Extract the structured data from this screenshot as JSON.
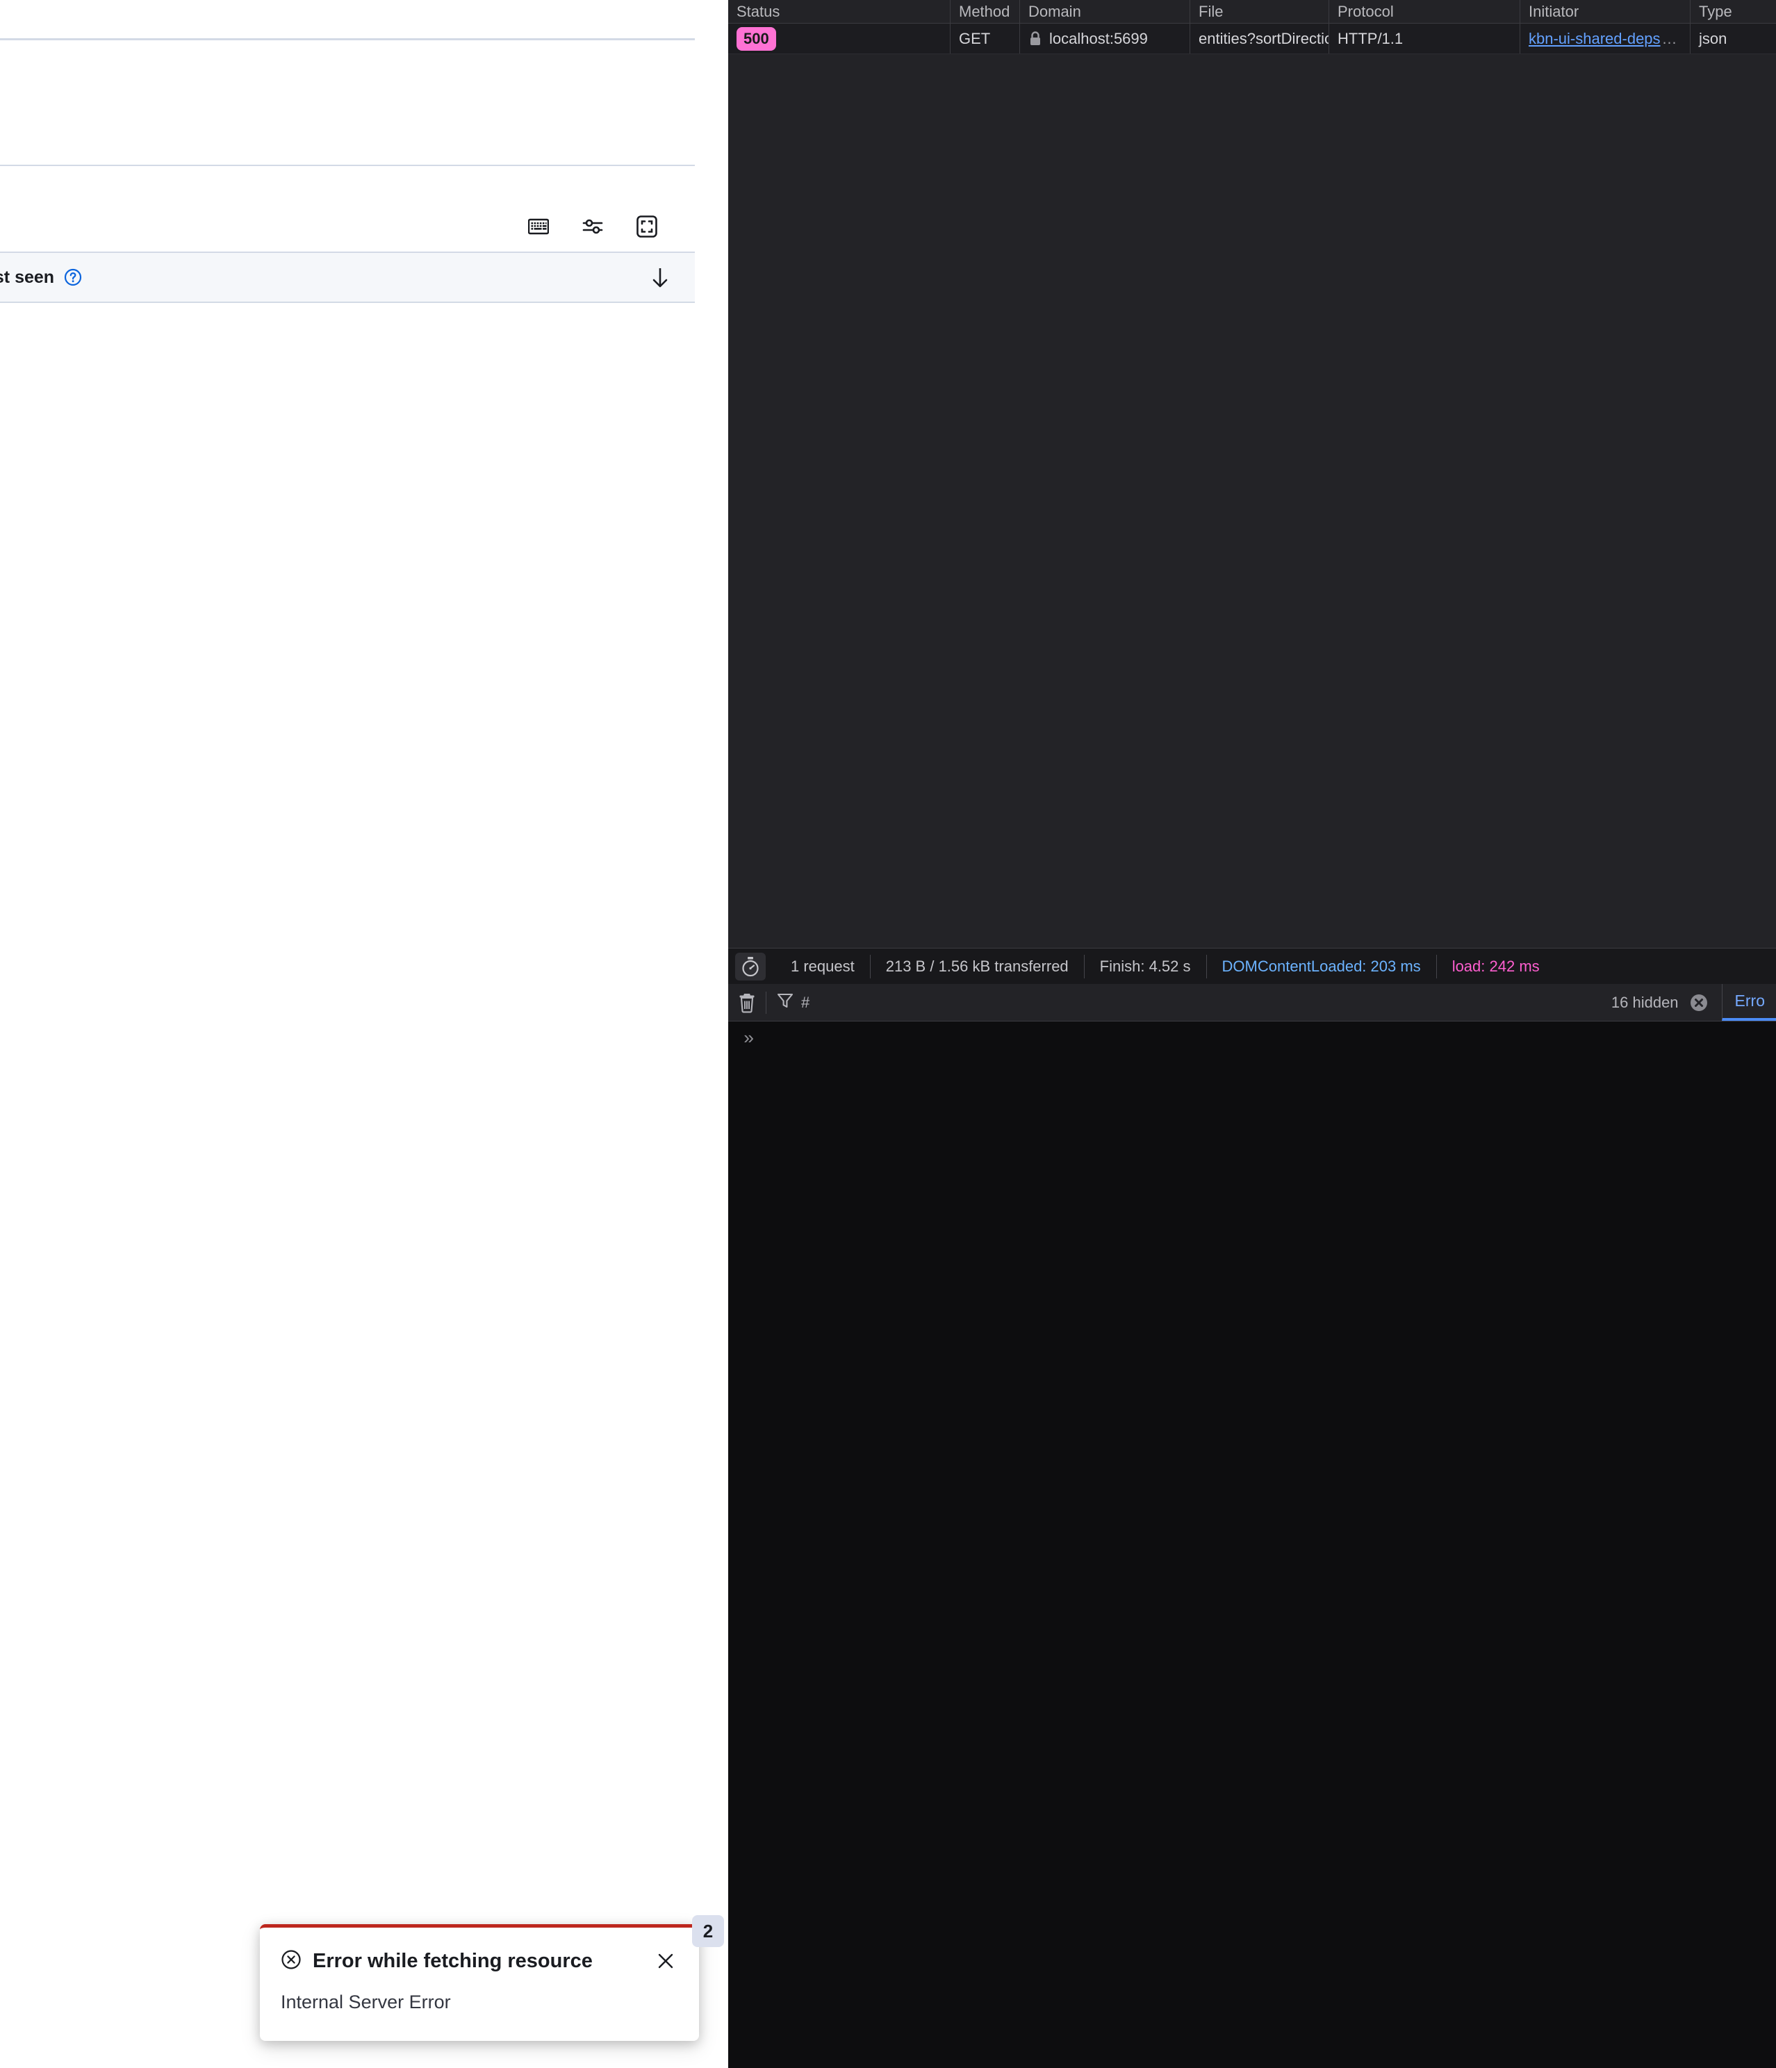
{
  "app": {
    "toolbar_icons": [
      {
        "name": "keyboard-shortcuts-icon",
        "label": "Keyboard shortcuts"
      },
      {
        "name": "display-options-icon",
        "label": "Display options"
      },
      {
        "name": "fullscreen-icon",
        "label": "Full screen"
      }
    ],
    "table": {
      "column_header": "ast seen",
      "help_icon": "help-circle-icon",
      "sort_icon": "sort-descending-arrow-icon"
    }
  },
  "devtools": {
    "network": {
      "columns": [
        "Status",
        "Method",
        "Domain",
        "File",
        "Protocol",
        "Initiator",
        "Type"
      ],
      "rows": [
        {
          "status": "500",
          "status_color": "#ff72d4",
          "method": "GET",
          "domain": "localhost:5699",
          "domain_icon": "lock-icon",
          "file": "entities?sortDirectio",
          "protocol": "HTTP/1.1",
          "initiator": "kbn-ui-shared-deps",
          "initiator_ellipsis": "…",
          "type": "json"
        }
      ],
      "status_bar": {
        "timer_icon": "stopwatch-icon",
        "requests": "1 request",
        "transferred": "213 B / 1.56 kB transferred",
        "finish": "Finish: 4.52 s",
        "dom_content_loaded": "DOMContentLoaded: 203 ms",
        "dom_content_loaded_color": "#6cb3ff",
        "load": "load: 242 ms",
        "load_color": "#ff5fd0"
      }
    },
    "console": {
      "clear_icon": "trash-icon",
      "filter_icon": "funnel-icon",
      "filter_placeholder": "#",
      "hidden_label": "16 hidden",
      "clear_filter_icon": "clear-circle-icon",
      "errors_tab": "Erro",
      "prompt": "»"
    }
  },
  "toast": {
    "error_icon": "error-cross-circle-icon",
    "title": "Error while fetching resource",
    "body": "Internal Server Error",
    "close_icon": "close-icon",
    "count_badge": "2",
    "accent_color": "#bd271e"
  }
}
